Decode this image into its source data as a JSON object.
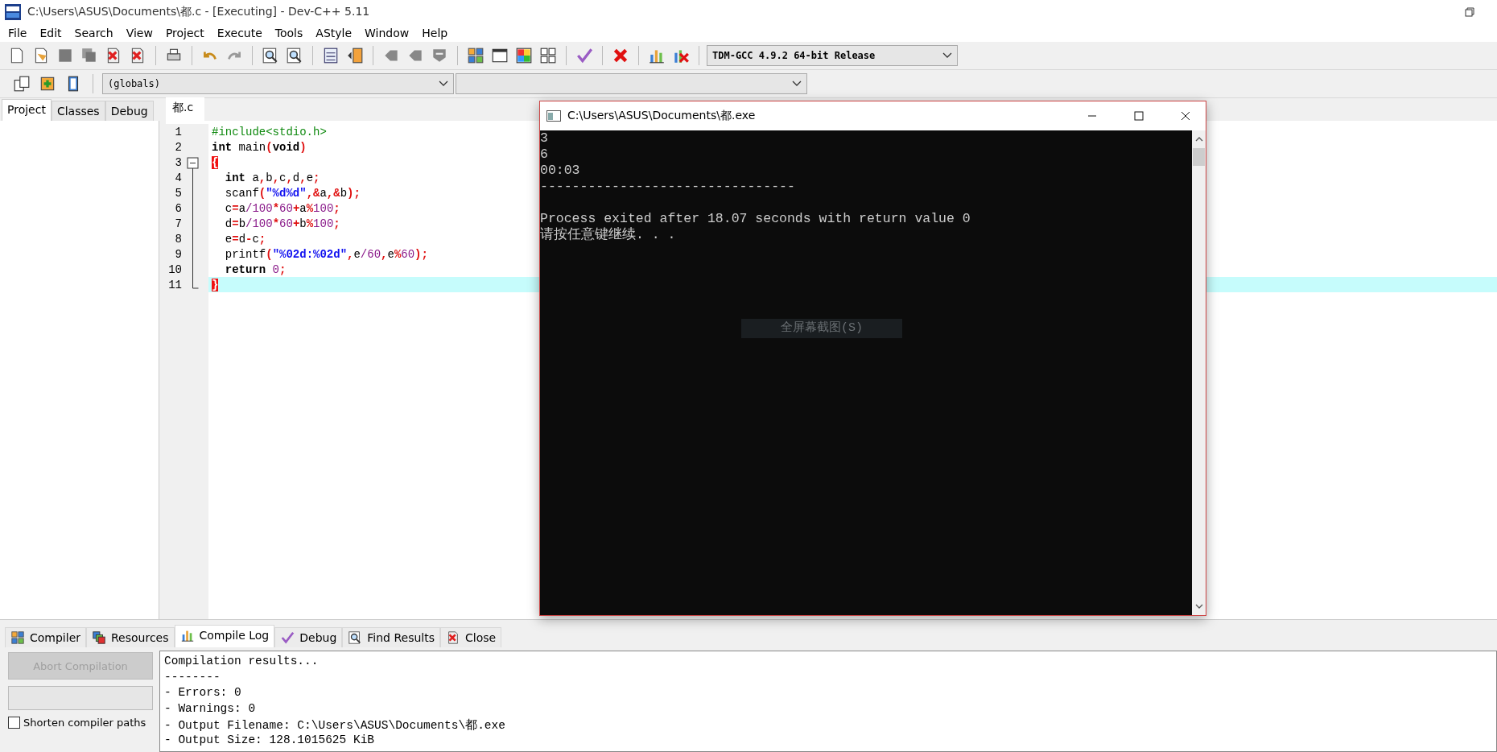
{
  "window": {
    "title": "C:\\Users\\ASUS\\Documents\\都.c - [Executing] - Dev-C++ 5.11"
  },
  "menu": [
    "File",
    "Edit",
    "Search",
    "View",
    "Project",
    "Execute",
    "Tools",
    "AStyle",
    "Window",
    "Help"
  ],
  "compiler_select": {
    "value": "TDM-GCC 4.9.2 64-bit Release"
  },
  "scope_select": {
    "value": "(globals)"
  },
  "left_tabs": [
    {
      "label": "Project",
      "selected": true
    },
    {
      "label": "Classes",
      "selected": false
    },
    {
      "label": "Debug",
      "selected": false
    }
  ],
  "editor": {
    "tabs": [
      {
        "label": "都.c",
        "selected": true
      }
    ],
    "lines": [
      {
        "number": "1",
        "current": false,
        "tokens": [
          {
            "t": "#include<stdio.h>",
            "kind": "pre"
          }
        ]
      },
      {
        "number": "2",
        "current": false,
        "tokens": [
          {
            "t": "int",
            "kind": "kw"
          },
          {
            "t": " main",
            "kind": "id"
          },
          {
            "t": "(",
            "kind": "sym"
          },
          {
            "t": "void",
            "kind": "kw"
          },
          {
            "t": ")",
            "kind": "sym"
          }
        ]
      },
      {
        "number": "3",
        "current": false,
        "tokens": [
          {
            "t": "{",
            "kind": "match"
          }
        ]
      },
      {
        "number": "4",
        "current": false,
        "tokens": [
          {
            "t": "  int",
            "kind": "kw"
          },
          {
            "t": " a",
            "kind": "id"
          },
          {
            "t": ",",
            "kind": "sym"
          },
          {
            "t": "b",
            "kind": "id"
          },
          {
            "t": ",",
            "kind": "sym"
          },
          {
            "t": "c",
            "kind": "id"
          },
          {
            "t": ",",
            "kind": "sym"
          },
          {
            "t": "d",
            "kind": "id"
          },
          {
            "t": ",",
            "kind": "sym"
          },
          {
            "t": "e",
            "kind": "id"
          },
          {
            "t": ";",
            "kind": "sym"
          }
        ]
      },
      {
        "number": "5",
        "current": false,
        "tokens": [
          {
            "t": "  scanf",
            "kind": "id"
          },
          {
            "t": "(",
            "kind": "sym"
          },
          {
            "t": "\"%d%d\"",
            "kind": "str"
          },
          {
            "t": ",&",
            "kind": "sym"
          },
          {
            "t": "a",
            "kind": "id"
          },
          {
            "t": ",&",
            "kind": "sym"
          },
          {
            "t": "b",
            "kind": "id"
          },
          {
            "t": ");",
            "kind": "sym"
          }
        ]
      },
      {
        "number": "6",
        "current": false,
        "tokens": [
          {
            "t": "  c",
            "kind": "id"
          },
          {
            "t": "=",
            "kind": "sym"
          },
          {
            "t": "a",
            "kind": "id"
          },
          {
            "t": "/",
            "kind": "num"
          },
          {
            "t": "100",
            "kind": "num"
          },
          {
            "t": "*",
            "kind": "sym"
          },
          {
            "t": "60",
            "kind": "num"
          },
          {
            "t": "+",
            "kind": "sym"
          },
          {
            "t": "a",
            "kind": "id"
          },
          {
            "t": "%",
            "kind": "sym"
          },
          {
            "t": "100",
            "kind": "num"
          },
          {
            "t": ";",
            "kind": "sym"
          }
        ]
      },
      {
        "number": "7",
        "current": false,
        "tokens": [
          {
            "t": "  d",
            "kind": "id"
          },
          {
            "t": "=",
            "kind": "sym"
          },
          {
            "t": "b",
            "kind": "id"
          },
          {
            "t": "/",
            "kind": "num"
          },
          {
            "t": "100",
            "kind": "num"
          },
          {
            "t": "*",
            "kind": "sym"
          },
          {
            "t": "60",
            "kind": "num"
          },
          {
            "t": "+",
            "kind": "sym"
          },
          {
            "t": "b",
            "kind": "id"
          },
          {
            "t": "%",
            "kind": "sym"
          },
          {
            "t": "100",
            "kind": "num"
          },
          {
            "t": ";",
            "kind": "sym"
          }
        ]
      },
      {
        "number": "8",
        "current": false,
        "tokens": [
          {
            "t": "  e",
            "kind": "id"
          },
          {
            "t": "=",
            "kind": "sym"
          },
          {
            "t": "d",
            "kind": "id"
          },
          {
            "t": "-",
            "kind": "sym"
          },
          {
            "t": "c",
            "kind": "id"
          },
          {
            "t": ";",
            "kind": "sym"
          }
        ]
      },
      {
        "number": "9",
        "current": false,
        "tokens": [
          {
            "t": "  printf",
            "kind": "id"
          },
          {
            "t": "(",
            "kind": "sym"
          },
          {
            "t": "\"%02d:%02d\"",
            "kind": "str"
          },
          {
            "t": ",",
            "kind": "sym"
          },
          {
            "t": "e",
            "kind": "id"
          },
          {
            "t": "/",
            "kind": "num"
          },
          {
            "t": "60",
            "kind": "num"
          },
          {
            "t": ",",
            "kind": "sym"
          },
          {
            "t": "e",
            "kind": "id"
          },
          {
            "t": "%",
            "kind": "sym"
          },
          {
            "t": "60",
            "kind": "num"
          },
          {
            "t": ");",
            "kind": "sym"
          }
        ]
      },
      {
        "number": "10",
        "current": false,
        "tokens": [
          {
            "t": "  return",
            "kind": "kw"
          },
          {
            "t": " 0",
            "kind": "num"
          },
          {
            "t": ";",
            "kind": "sym"
          }
        ]
      },
      {
        "number": "11",
        "current": true,
        "tokens": [
          {
            "t": "}",
            "kind": "match"
          }
        ]
      }
    ]
  },
  "console": {
    "title": "C:\\Users\\ASUS\\Documents\\都.exe",
    "output": [
      "3",
      "6",
      "00:03"
    ],
    "separator": "--------------------------------",
    "messages": [
      "Process exited after 18.07 seconds with return value 0",
      "请按任意键继续. . ."
    ]
  },
  "overlay": {
    "label": "全屏幕截图(S)"
  },
  "bottom_tabs": [
    {
      "label": "Compiler",
      "selected": false
    },
    {
      "label": "Resources",
      "selected": false
    },
    {
      "label": "Compile Log",
      "selected": true
    },
    {
      "label": "Debug",
      "selected": false
    },
    {
      "label": "Find Results",
      "selected": false
    },
    {
      "label": "Close",
      "selected": false
    }
  ],
  "abort_button": {
    "label": "Abort Compilation",
    "disabled": true
  },
  "progress": {
    "level": 0
  },
  "shorten_paths": {
    "label": "Shorten compiler paths",
    "checked": false
  },
  "log": [
    "Compilation results...",
    "--------",
    "- Errors: 0",
    "- Warnings: 0",
    "- Output Filename: C:\\Users\\ASUS\\Documents\\都.exe",
    "- Output Size: 128.1015625 KiB"
  ]
}
